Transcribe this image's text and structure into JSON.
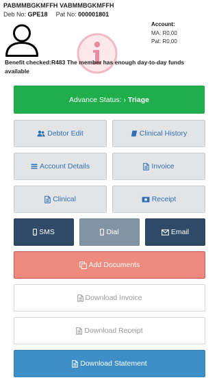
{
  "patient": {
    "name": "PABMMBGKMFFH VABMMBGKMFFH",
    "deb_label": "Deb No:",
    "deb_no": "GPE18",
    "pat_label": "Pat No:",
    "pat_no": "000001801"
  },
  "account": {
    "title": "Account:",
    "ma_label": "MA:",
    "ma_value": "R0,00",
    "pat_label": "Pat:",
    "pat_value": "R0,00"
  },
  "benefit": {
    "label": "Benefit checked:",
    "message": "R483 The member has enough day-to-day funds available"
  },
  "buttons": {
    "advance_prefix": "Advance Status:",
    "advance_arrow": "›",
    "advance_value": "Triage",
    "debtor_edit": "Debtor Edit",
    "clinical_history": "Clinical History",
    "account_details": "Account Details",
    "invoice": "Invoice",
    "clinical": "Clinical",
    "receipt": "Receipt",
    "sms": "SMS",
    "dial": "Dial",
    "email": "Email",
    "add_documents": "Add Documents",
    "download_invoice": "Download Invoice",
    "download_receipt": "Download Receipt",
    "download_statement": "Download Statement"
  },
  "icons": {
    "avatar": "user-outline-icon",
    "watermark": "info-icon",
    "debtor_edit": "users-icon",
    "clinical_history": "book-icon",
    "account_details": "list-icon",
    "invoice": "file-text-icon",
    "clinical": "file-text-icon",
    "receipt": "money-icon",
    "sms": "mobile-icon",
    "dial": "mobile-icon",
    "email": "envelope-icon",
    "add_documents": "copy-icon",
    "download": "file-text-icon"
  },
  "colors": {
    "advance_green": "#1fae4b",
    "grey_button": "#e3e4e6",
    "link_blue": "#2f6fb5",
    "navy": "#2e4a66",
    "slate": "#8294a4",
    "salmon": "#ee8b7e",
    "statement_blue": "#3e8fc8",
    "watermark_pink": "#e88aa0"
  }
}
